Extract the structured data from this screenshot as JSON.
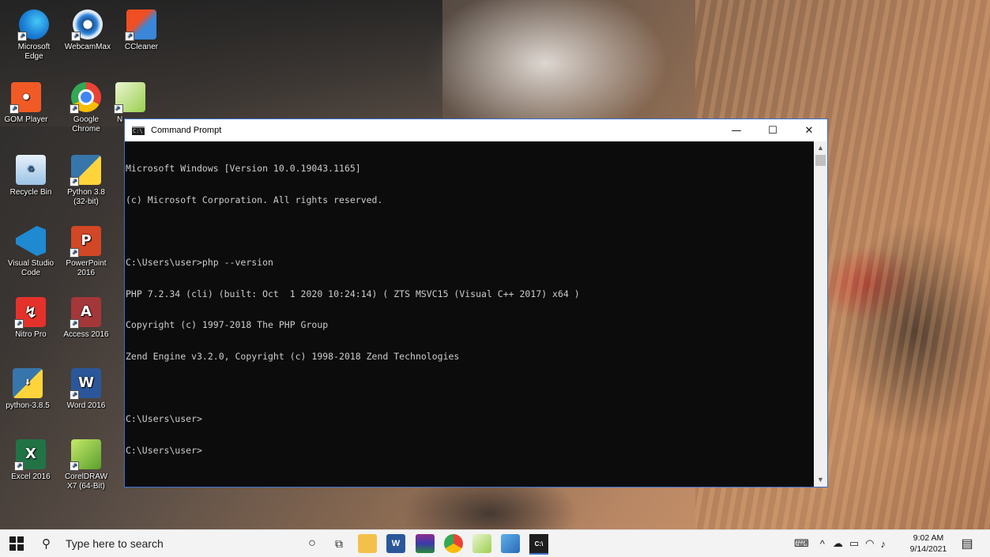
{
  "desktop": {
    "icons": [
      {
        "label": "Microsoft Edge",
        "icon": "edge-icon"
      },
      {
        "label": "WebcamMax",
        "icon": "webcammax-icon"
      },
      {
        "label": "CCleaner",
        "icon": "ccleaner-icon"
      },
      {
        "label": "GOM Player",
        "icon": "gom-player-icon"
      },
      {
        "label": "Google Chrome",
        "icon": "chrome-icon"
      },
      {
        "label": "N",
        "icon": "notepad-plus-icon"
      },
      {
        "label": "Recycle Bin",
        "icon": "recycle-bin-icon"
      },
      {
        "label": "Python 3.8 (32-bit)",
        "icon": "python-icon"
      },
      {
        "label": "Visual Studio Code",
        "icon": "vscode-icon"
      },
      {
        "label": "PowerPoint 2016",
        "icon": "powerpoint-icon"
      },
      {
        "label": "Nitro Pro",
        "icon": "nitro-pro-icon"
      },
      {
        "label": "Access 2016",
        "icon": "access-icon"
      },
      {
        "label": "python-3.8.5",
        "icon": "python-installer-icon"
      },
      {
        "label": "Word 2016",
        "icon": "word-icon"
      },
      {
        "label": "Excel 2016",
        "icon": "excel-icon"
      },
      {
        "label": "CorelDRAW X7 (64-Bit)",
        "icon": "coreldraw-icon"
      }
    ]
  },
  "cmd": {
    "title": "Command Prompt",
    "controls": {
      "minimize": "—",
      "maximize": "☐",
      "close": "✕"
    },
    "lines": [
      "Microsoft Windows [Version 10.0.19043.1165]",
      "(c) Microsoft Corporation. All rights reserved.",
      "",
      "C:\\Users\\user>php --version",
      "PHP 7.2.34 (cli) (built: Oct  1 2020 10:24:14) ( ZTS MSVC15 (Visual C++ 2017) x64 )",
      "Copyright (c) 1997-2018 The PHP Group",
      "Zend Engine v3.2.0, Copyright (c) 1998-2018 Zend Technologies",
      "",
      "C:\\Users\\user>",
      "C:\\Users\\user>"
    ]
  },
  "taskbar": {
    "search_placeholder": "Type here to search",
    "apps": [
      "cortana-icon",
      "task-view-icon",
      "file-explorer-icon",
      "word-icon",
      "winrar-icon",
      "chrome-icon",
      "notepad-plus-icon",
      "paint-icon",
      "command-prompt-icon"
    ],
    "time": "9:02 AM",
    "date": "9/14/2021"
  }
}
